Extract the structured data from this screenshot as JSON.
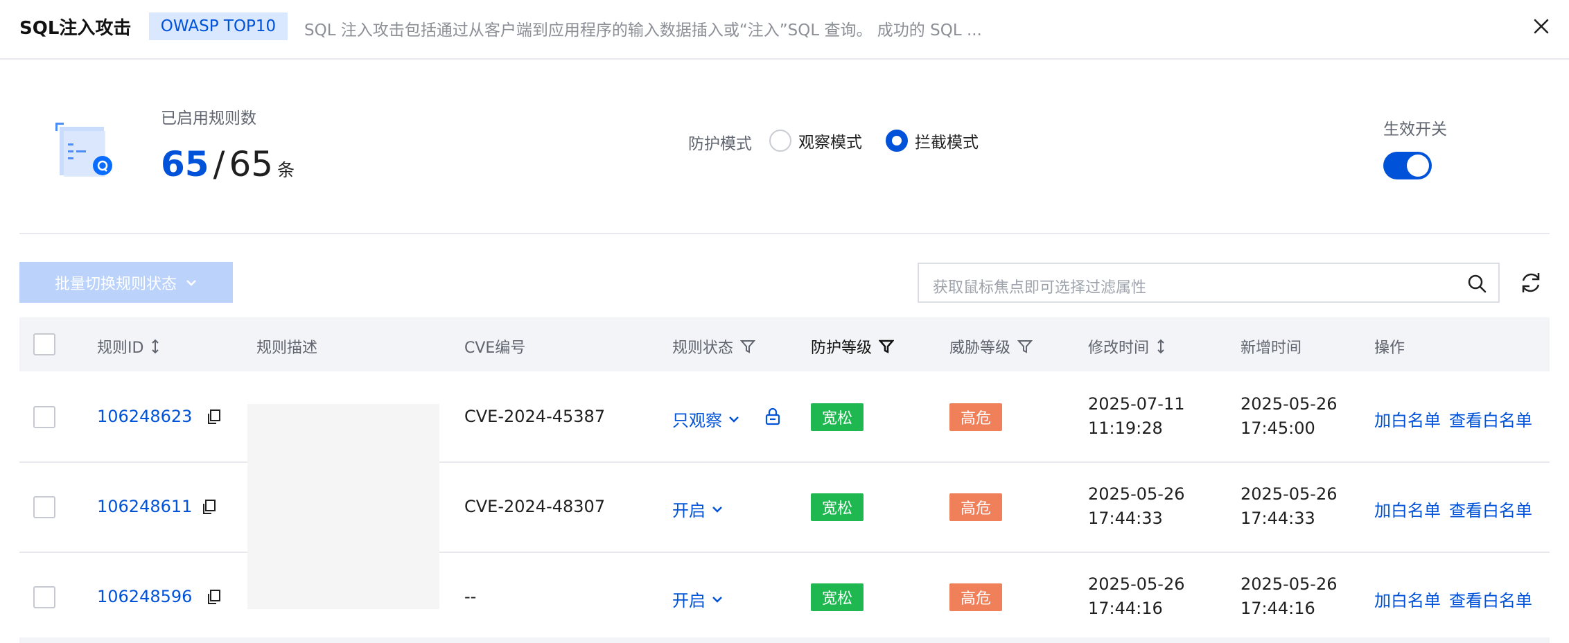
{
  "header": {
    "title": "SQL注入攻击",
    "tag": "OWASP TOP10",
    "description": "SQL 注入攻击包括通过从客户端到应用程序的输入数据插入或“注入”SQL 查询。 成功的 SQL ..."
  },
  "summary": {
    "enabled_label": "已启用规则数",
    "enabled_count": "65",
    "separator": "/",
    "total_count": "65",
    "unit": "条",
    "mode_label": "防护模式",
    "mode_observe": "观察模式",
    "mode_block": "拦截模式",
    "selected_mode": "拦截模式",
    "switch_label": "生效开关",
    "switch_on": true
  },
  "toolbar": {
    "batch_label": "批量切换规则状态",
    "search_placeholder": "获取鼠标焦点即可选择过滤属性"
  },
  "table": {
    "columns": {
      "rule_id": "规则ID",
      "rule_desc": "规则描述",
      "cve": "CVE编号",
      "status": "规则状态",
      "protect_level": "防护等级",
      "threat_level": "威胁等级",
      "modified": "修改时间",
      "created": "新增时间",
      "actions": "操作"
    },
    "rows": [
      {
        "id": "106248623",
        "cve": "CVE-2024-45387",
        "status": "只观察",
        "protect": "宽松",
        "threat": "高危",
        "modified_date": "2025-07-11",
        "modified_time": "11:19:28",
        "created_date": "2025-05-26",
        "created_time": "17:45:00",
        "action_add": "加白名单",
        "action_view": "查看白名单"
      },
      {
        "id": "106248611",
        "cve": "CVE-2024-48307",
        "status": "开启",
        "protect": "宽松",
        "threat": "高危",
        "modified_date": "2025-05-26",
        "modified_time": "17:44:33",
        "created_date": "2025-05-26",
        "created_time": "17:44:33",
        "action_add": "加白名单",
        "action_view": "查看白名单"
      },
      {
        "id": "106248596",
        "cve": "--",
        "status": "开启",
        "protect": "宽松",
        "threat": "高危",
        "modified_date": "2025-05-26",
        "modified_time": "17:44:16",
        "created_date": "2025-05-26",
        "created_time": "17:44:16",
        "action_add": "加白名单",
        "action_view": "查看白名单"
      }
    ]
  },
  "colors": {
    "brand_blue": "#0052d9",
    "badge_green": "#1fb850",
    "badge_orange": "#f0805a"
  }
}
